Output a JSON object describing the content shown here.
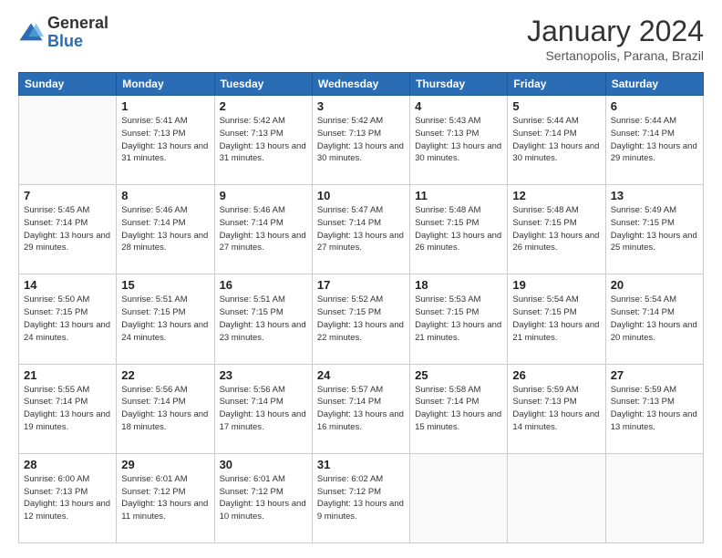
{
  "logo": {
    "general": "General",
    "blue": "Blue"
  },
  "title": "January 2024",
  "subtitle": "Sertanopolis, Parana, Brazil",
  "days_header": [
    "Sunday",
    "Monday",
    "Tuesday",
    "Wednesday",
    "Thursday",
    "Friday",
    "Saturday"
  ],
  "weeks": [
    [
      {
        "day": "",
        "sunrise": "",
        "sunset": "",
        "daylight": ""
      },
      {
        "day": "1",
        "sunrise": "Sunrise: 5:41 AM",
        "sunset": "Sunset: 7:13 PM",
        "daylight": "Daylight: 13 hours and 31 minutes."
      },
      {
        "day": "2",
        "sunrise": "Sunrise: 5:42 AM",
        "sunset": "Sunset: 7:13 PM",
        "daylight": "Daylight: 13 hours and 31 minutes."
      },
      {
        "day": "3",
        "sunrise": "Sunrise: 5:42 AM",
        "sunset": "Sunset: 7:13 PM",
        "daylight": "Daylight: 13 hours and 30 minutes."
      },
      {
        "day": "4",
        "sunrise": "Sunrise: 5:43 AM",
        "sunset": "Sunset: 7:13 PM",
        "daylight": "Daylight: 13 hours and 30 minutes."
      },
      {
        "day": "5",
        "sunrise": "Sunrise: 5:44 AM",
        "sunset": "Sunset: 7:14 PM",
        "daylight": "Daylight: 13 hours and 30 minutes."
      },
      {
        "day": "6",
        "sunrise": "Sunrise: 5:44 AM",
        "sunset": "Sunset: 7:14 PM",
        "daylight": "Daylight: 13 hours and 29 minutes."
      }
    ],
    [
      {
        "day": "7",
        "sunrise": "Sunrise: 5:45 AM",
        "sunset": "Sunset: 7:14 PM",
        "daylight": "Daylight: 13 hours and 29 minutes."
      },
      {
        "day": "8",
        "sunrise": "Sunrise: 5:46 AM",
        "sunset": "Sunset: 7:14 PM",
        "daylight": "Daylight: 13 hours and 28 minutes."
      },
      {
        "day": "9",
        "sunrise": "Sunrise: 5:46 AM",
        "sunset": "Sunset: 7:14 PM",
        "daylight": "Daylight: 13 hours and 27 minutes."
      },
      {
        "day": "10",
        "sunrise": "Sunrise: 5:47 AM",
        "sunset": "Sunset: 7:14 PM",
        "daylight": "Daylight: 13 hours and 27 minutes."
      },
      {
        "day": "11",
        "sunrise": "Sunrise: 5:48 AM",
        "sunset": "Sunset: 7:15 PM",
        "daylight": "Daylight: 13 hours and 26 minutes."
      },
      {
        "day": "12",
        "sunrise": "Sunrise: 5:48 AM",
        "sunset": "Sunset: 7:15 PM",
        "daylight": "Daylight: 13 hours and 26 minutes."
      },
      {
        "day": "13",
        "sunrise": "Sunrise: 5:49 AM",
        "sunset": "Sunset: 7:15 PM",
        "daylight": "Daylight: 13 hours and 25 minutes."
      }
    ],
    [
      {
        "day": "14",
        "sunrise": "Sunrise: 5:50 AM",
        "sunset": "Sunset: 7:15 PM",
        "daylight": "Daylight: 13 hours and 24 minutes."
      },
      {
        "day": "15",
        "sunrise": "Sunrise: 5:51 AM",
        "sunset": "Sunset: 7:15 PM",
        "daylight": "Daylight: 13 hours and 24 minutes."
      },
      {
        "day": "16",
        "sunrise": "Sunrise: 5:51 AM",
        "sunset": "Sunset: 7:15 PM",
        "daylight": "Daylight: 13 hours and 23 minutes."
      },
      {
        "day": "17",
        "sunrise": "Sunrise: 5:52 AM",
        "sunset": "Sunset: 7:15 PM",
        "daylight": "Daylight: 13 hours and 22 minutes."
      },
      {
        "day": "18",
        "sunrise": "Sunrise: 5:53 AM",
        "sunset": "Sunset: 7:15 PM",
        "daylight": "Daylight: 13 hours and 21 minutes."
      },
      {
        "day": "19",
        "sunrise": "Sunrise: 5:54 AM",
        "sunset": "Sunset: 7:15 PM",
        "daylight": "Daylight: 13 hours and 21 minutes."
      },
      {
        "day": "20",
        "sunrise": "Sunrise: 5:54 AM",
        "sunset": "Sunset: 7:14 PM",
        "daylight": "Daylight: 13 hours and 20 minutes."
      }
    ],
    [
      {
        "day": "21",
        "sunrise": "Sunrise: 5:55 AM",
        "sunset": "Sunset: 7:14 PM",
        "daylight": "Daylight: 13 hours and 19 minutes."
      },
      {
        "day": "22",
        "sunrise": "Sunrise: 5:56 AM",
        "sunset": "Sunset: 7:14 PM",
        "daylight": "Daylight: 13 hours and 18 minutes."
      },
      {
        "day": "23",
        "sunrise": "Sunrise: 5:56 AM",
        "sunset": "Sunset: 7:14 PM",
        "daylight": "Daylight: 13 hours and 17 minutes."
      },
      {
        "day": "24",
        "sunrise": "Sunrise: 5:57 AM",
        "sunset": "Sunset: 7:14 PM",
        "daylight": "Daylight: 13 hours and 16 minutes."
      },
      {
        "day": "25",
        "sunrise": "Sunrise: 5:58 AM",
        "sunset": "Sunset: 7:14 PM",
        "daylight": "Daylight: 13 hours and 15 minutes."
      },
      {
        "day": "26",
        "sunrise": "Sunrise: 5:59 AM",
        "sunset": "Sunset: 7:13 PM",
        "daylight": "Daylight: 13 hours and 14 minutes."
      },
      {
        "day": "27",
        "sunrise": "Sunrise: 5:59 AM",
        "sunset": "Sunset: 7:13 PM",
        "daylight": "Daylight: 13 hours and 13 minutes."
      }
    ],
    [
      {
        "day": "28",
        "sunrise": "Sunrise: 6:00 AM",
        "sunset": "Sunset: 7:13 PM",
        "daylight": "Daylight: 13 hours and 12 minutes."
      },
      {
        "day": "29",
        "sunrise": "Sunrise: 6:01 AM",
        "sunset": "Sunset: 7:12 PM",
        "daylight": "Daylight: 13 hours and 11 minutes."
      },
      {
        "day": "30",
        "sunrise": "Sunrise: 6:01 AM",
        "sunset": "Sunset: 7:12 PM",
        "daylight": "Daylight: 13 hours and 10 minutes."
      },
      {
        "day": "31",
        "sunrise": "Sunrise: 6:02 AM",
        "sunset": "Sunset: 7:12 PM",
        "daylight": "Daylight: 13 hours and 9 minutes."
      },
      {
        "day": "",
        "sunrise": "",
        "sunset": "",
        "daylight": ""
      },
      {
        "day": "",
        "sunrise": "",
        "sunset": "",
        "daylight": ""
      },
      {
        "day": "",
        "sunrise": "",
        "sunset": "",
        "daylight": ""
      }
    ]
  ]
}
